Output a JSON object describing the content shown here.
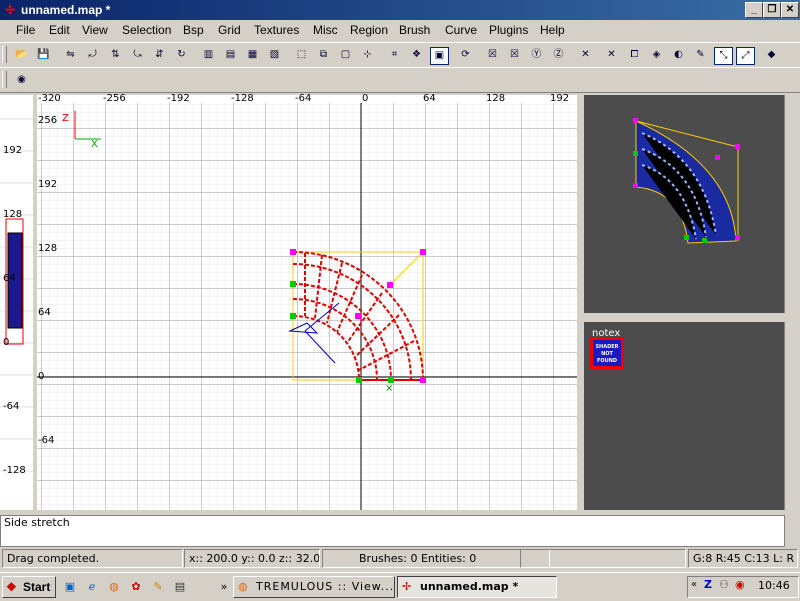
{
  "window": {
    "title": "unnamed.map *",
    "min": "_",
    "max": "❐",
    "close": "✕"
  },
  "menu": [
    "File",
    "Edit",
    "View",
    "Selection",
    "Bsp",
    "Grid",
    "Textures",
    "Misc",
    "Region",
    "Brush",
    "Curve",
    "Plugins",
    "Help"
  ],
  "xy_view": {
    "x_ticks": [
      "-320",
      "-256",
      "-192",
      "-128",
      "-64",
      "0",
      "64",
      "128",
      "192"
    ],
    "y_ticks": [
      "256",
      "192",
      "128",
      "64",
      "0",
      "-64"
    ],
    "axis_labels": {
      "vertical": "Z",
      "horizontal": "X"
    }
  },
  "z_view": {
    "ticks": [
      "192",
      "128",
      "64",
      "0",
      "-64",
      "-128"
    ]
  },
  "texture": {
    "name": "notex",
    "preview_text": "SHADER NOT FOUND"
  },
  "console": {
    "last_line": "Side stretch"
  },
  "status": {
    "message": "Drag completed.",
    "coords": "x:: 200.0  y:: 0.0  z:: 32.0",
    "counts": "Brushes: 0 Entities: 0",
    "extra": "",
    "grid_info": "G:8 R:45 C:13 L: R"
  },
  "taskbar": {
    "start": "Start",
    "more": "»",
    "tasks": [
      {
        "label": "TREMULOUS :: View..."
      },
      {
        "label": "unnamed.map *"
      }
    ],
    "clock": "10:46",
    "tray_more": "«"
  },
  "colors": {
    "accent": "#0a246a",
    "brush": "#e00000",
    "selection": "#ffcc00",
    "handle": "#ff00ff",
    "vertex": "#00cc00"
  }
}
